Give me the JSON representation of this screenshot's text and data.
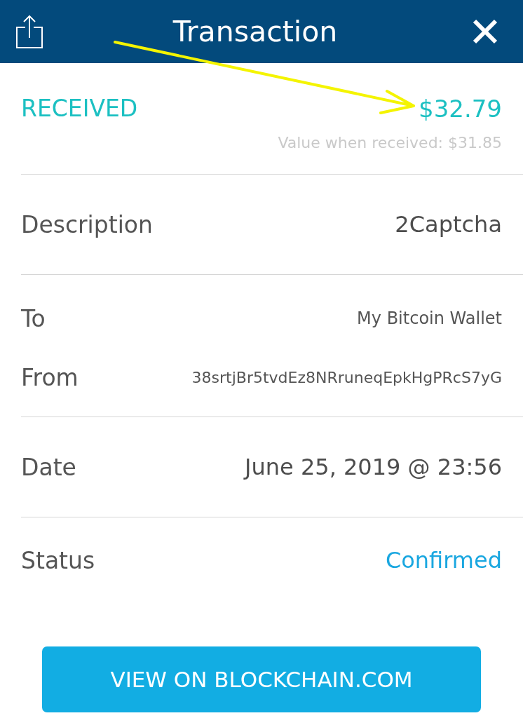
{
  "header": {
    "title": "Transaction"
  },
  "summary": {
    "direction": "RECEIVED",
    "amount": "$32.79",
    "note": "Value when received: $31.85"
  },
  "sections": [
    {
      "rows": [
        {
          "kind": "plain",
          "label": "Description",
          "value": "2Captcha"
        }
      ]
    },
    {
      "rows": [
        {
          "kind": "account",
          "label": "To",
          "value": "My Bitcoin Wallet"
        },
        {
          "kind": "address",
          "label": "From",
          "value": "38srtjBr5tvdEz8NRruneqEpkHgPRcS7yG"
        }
      ]
    },
    {
      "rows": [
        {
          "kind": "plain",
          "label": "Date",
          "value": "June 25, 2019 @ 23:56"
        }
      ]
    },
    {
      "rows": [
        {
          "kind": "status",
          "label": "Status",
          "value": "Confirmed"
        }
      ]
    }
  ],
  "action": {
    "label": "VIEW ON BLOCKCHAIN.COM"
  }
}
